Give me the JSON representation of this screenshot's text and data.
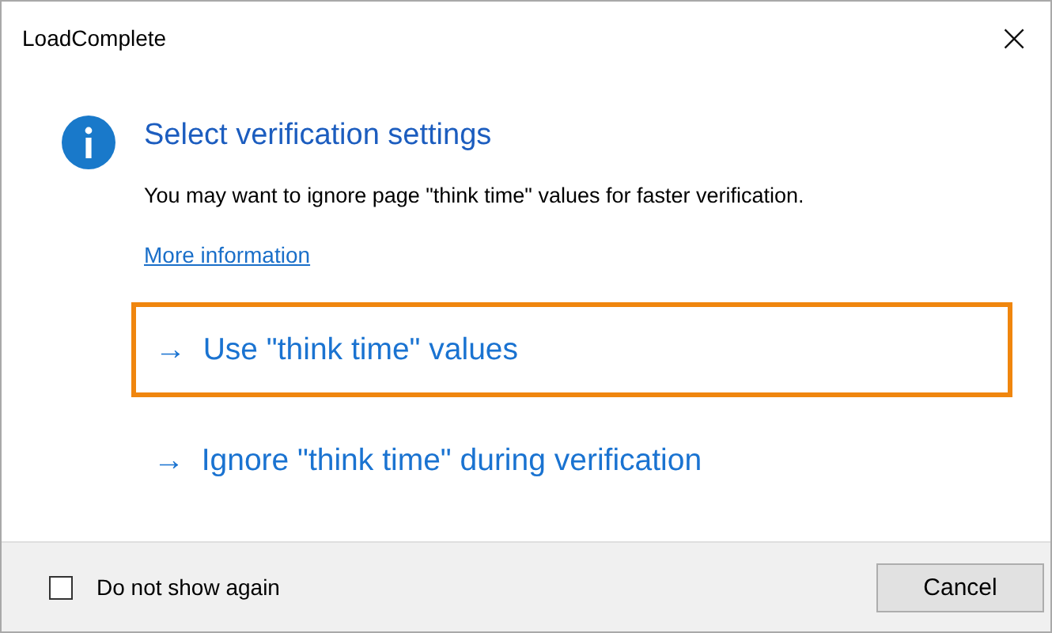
{
  "window": {
    "title": "LoadComplete",
    "close": "×"
  },
  "heading": "Select verification settings",
  "message": "You may want to ignore page \"think time\" values for faster verification.",
  "link": "More information",
  "options": [
    {
      "arrow": "→",
      "label": "Use \"think time\" values",
      "selected": true
    },
    {
      "arrow": "→",
      "label": "Ignore \"think time\" during verification",
      "selected": false
    }
  ],
  "checkbox": {
    "label": "Do not show again",
    "checked": false
  },
  "buttons": [
    "Cancel"
  ]
}
